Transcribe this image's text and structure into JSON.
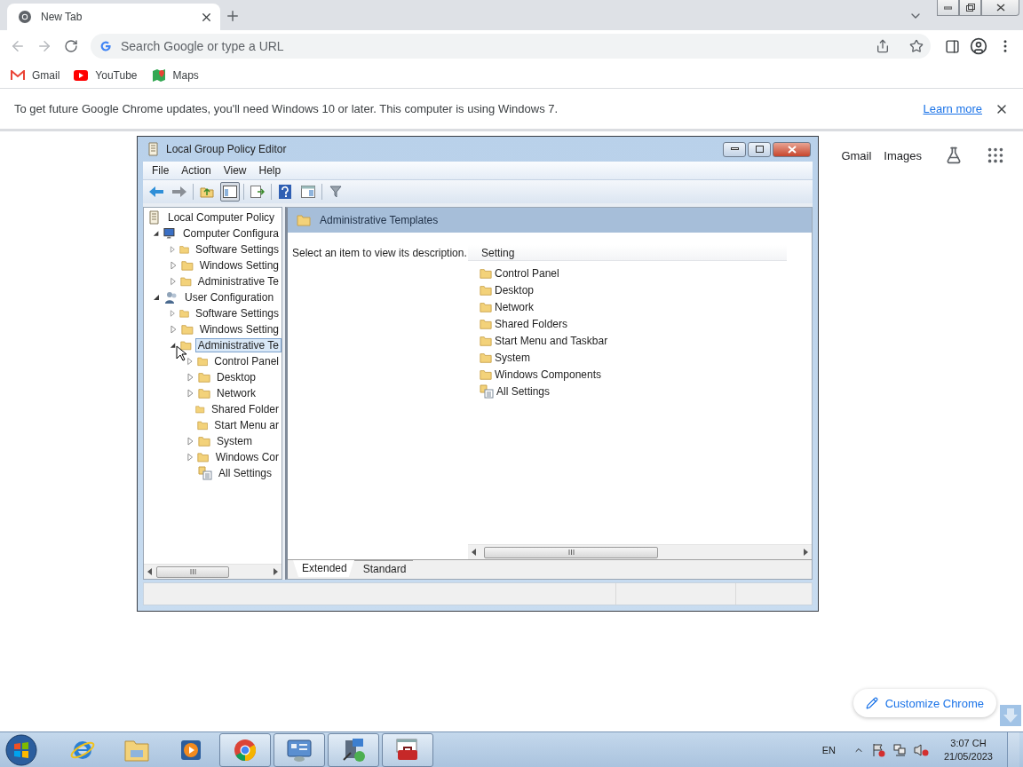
{
  "browser": {
    "tab": {
      "title": "New Tab"
    },
    "omnibox": {
      "placeholder": "Search Google or type a URL"
    },
    "bookmarks": [
      {
        "label": "Gmail",
        "kind": "gmail"
      },
      {
        "label": "YouTube",
        "kind": "youtube"
      },
      {
        "label": "Maps",
        "kind": "maps"
      }
    ],
    "infobar": {
      "message": "To get future Google Chrome updates, you'll need Windows 10 or later. This computer is using Windows 7.",
      "link": "Learn more"
    }
  },
  "new_tab_page": {
    "links": [
      "Gmail",
      "Images"
    ],
    "customize_button": "Customize Chrome"
  },
  "gpedit": {
    "title": "Local Group Policy Editor",
    "menu": [
      "File",
      "Action",
      "View",
      "Help"
    ],
    "tree": [
      {
        "label": "Local Computer Policy",
        "kind": "policy",
        "selected": false,
        "children": [
          {
            "label": "Computer Configura",
            "kind": "computer",
            "expanded": true,
            "selected": false,
            "children": [
              {
                "label": "Software Settings",
                "kind": "folder",
                "expanded": false,
                "selected": false
              },
              {
                "label": "Windows Setting",
                "kind": "folder",
                "expanded": false,
                "selected": false
              },
              {
                "label": "Administrative Te",
                "kind": "folder",
                "expanded": false,
                "selected": false
              }
            ]
          },
          {
            "label": "User Configuration",
            "kind": "user",
            "expanded": true,
            "selected": false,
            "children": [
              {
                "label": "Software Settings",
                "kind": "folder",
                "expanded": false,
                "selected": false
              },
              {
                "label": "Windows Setting",
                "kind": "folder",
                "expanded": false,
                "selected": false
              },
              {
                "label": "Administrative Te",
                "kind": "folder",
                "expanded": true,
                "selected": true,
                "children": [
                  {
                    "label": "Control Panel",
                    "kind": "folder",
                    "expanded": false,
                    "selected": false
                  },
                  {
                    "label": "Desktop",
                    "kind": "folder",
                    "expanded": false,
                    "selected": false
                  },
                  {
                    "label": "Network",
                    "kind": "folder",
                    "expanded": false,
                    "selected": false
                  },
                  {
                    "label": "Shared Folder",
                    "kind": "folder",
                    "selected": false
                  },
                  {
                    "label": "Start Menu ar",
                    "kind": "folder",
                    "selected": false
                  },
                  {
                    "label": "System",
                    "kind": "folder",
                    "expanded": false,
                    "selected": false
                  },
                  {
                    "label": "Windows Cor",
                    "kind": "folder",
                    "expanded": false,
                    "selected": false
                  },
                  {
                    "label": "All Settings",
                    "kind": "settings",
                    "selected": false
                  }
                ]
              }
            ]
          }
        ]
      }
    ],
    "header": "Administrative Templates",
    "description": "Select an item to view its description.",
    "column": "Setting",
    "items": [
      {
        "label": "Control Panel",
        "kind": "folder"
      },
      {
        "label": "Desktop",
        "kind": "folder"
      },
      {
        "label": "Network",
        "kind": "folder"
      },
      {
        "label": "Shared Folders",
        "kind": "folder"
      },
      {
        "label": "Start Menu and Taskbar",
        "kind": "folder"
      },
      {
        "label": "System",
        "kind": "folder"
      },
      {
        "label": "Windows Components",
        "kind": "folder"
      },
      {
        "label": "All Settings",
        "kind": "settings"
      }
    ],
    "tabs": [
      {
        "label": "Extended",
        "selected": true
      },
      {
        "label": "Standard",
        "selected": false
      }
    ]
  },
  "taskbar": {
    "apps": [
      {
        "kind": "ie",
        "running": false
      },
      {
        "kind": "explorer",
        "running": false
      },
      {
        "kind": "media",
        "running": false
      },
      {
        "kind": "chrome",
        "running": true
      },
      {
        "kind": "control",
        "running": true
      },
      {
        "kind": "setup",
        "running": true
      },
      {
        "kind": "toolbox",
        "running": true
      }
    ],
    "language": "EN",
    "time": "3:07 CH",
    "date": "21/05/2023"
  }
}
